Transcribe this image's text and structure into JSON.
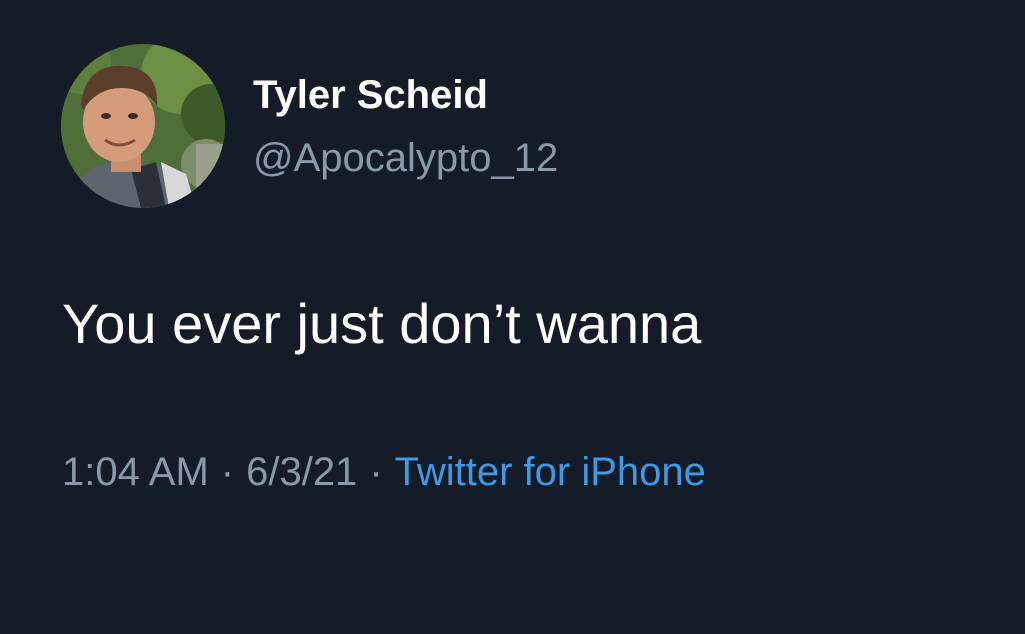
{
  "tweet": {
    "author": {
      "name": "Tyler Scheid",
      "handle": "@Apocalypto_12",
      "avatar": "profile-photo"
    },
    "text": "You ever just don’t wanna",
    "meta": {
      "time": "1:04 AM",
      "separator": "·",
      "date": "6/3/21",
      "source": "Twitter for iPhone"
    }
  },
  "colors": {
    "background": "#151c28",
    "primary_text": "#ffffff",
    "secondary_text": "#8a99a8",
    "link": "#3f9ae6"
  }
}
